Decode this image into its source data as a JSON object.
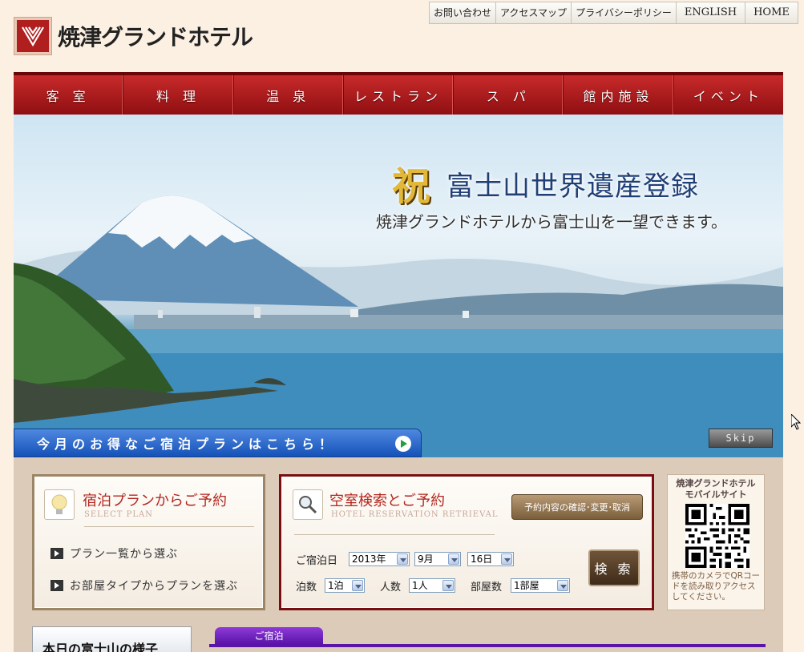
{
  "header": {
    "hotel_name": "焼津グランドホテル",
    "utility_links": [
      "お問い合わせ",
      "アクセスマップ",
      "プライバシーポリシー",
      "ENGLISH",
      "HOME"
    ]
  },
  "main_nav": [
    "客 室",
    "料 理",
    "温 泉",
    "レストラン",
    "ス パ",
    "館内施設",
    "イベント"
  ],
  "hero": {
    "kanji": "祝",
    "title": "富士山世界遺産登録",
    "subtitle": "焼津グランドホテルから富士山を一望できます。",
    "plan_banner": "今月のお得なご宿泊プランはこちら！",
    "skip_label": "Skip"
  },
  "plan_box": {
    "title": "宿泊プランからご予約",
    "subtitle": "SELECT PLAN",
    "links": [
      "プラン一覧から選ぶ",
      "お部屋タイプからプランを選ぶ"
    ]
  },
  "search_box": {
    "title": "空室検索とご予約",
    "subtitle": "HOTEL RESERVATION RETRIEVAL",
    "confirm_label": "予約内容の確認･変更･取消",
    "date_label": "ご宿泊日",
    "year": "2013年",
    "month": "9月",
    "day": "16日",
    "nights_label": "泊数",
    "nights": "1泊",
    "people_label": "人数",
    "people": "1人",
    "rooms_label": "部屋数",
    "rooms": "1部屋",
    "search_label": "検 索"
  },
  "mobile_box": {
    "title": "焼津グランドホテル\nモバイルサイト",
    "note": "携帯のカメラでQRコードを読み取りアクセスしてください。"
  },
  "bottom": {
    "fuji_title": "本日の富士山の様子",
    "tab_stay": "ご宿泊"
  },
  "colors": {
    "nav_red": "#b01e1e",
    "search_border": "#7a0d11",
    "plan_border": "#9c8565",
    "tab_purple": "#5a14a8"
  }
}
